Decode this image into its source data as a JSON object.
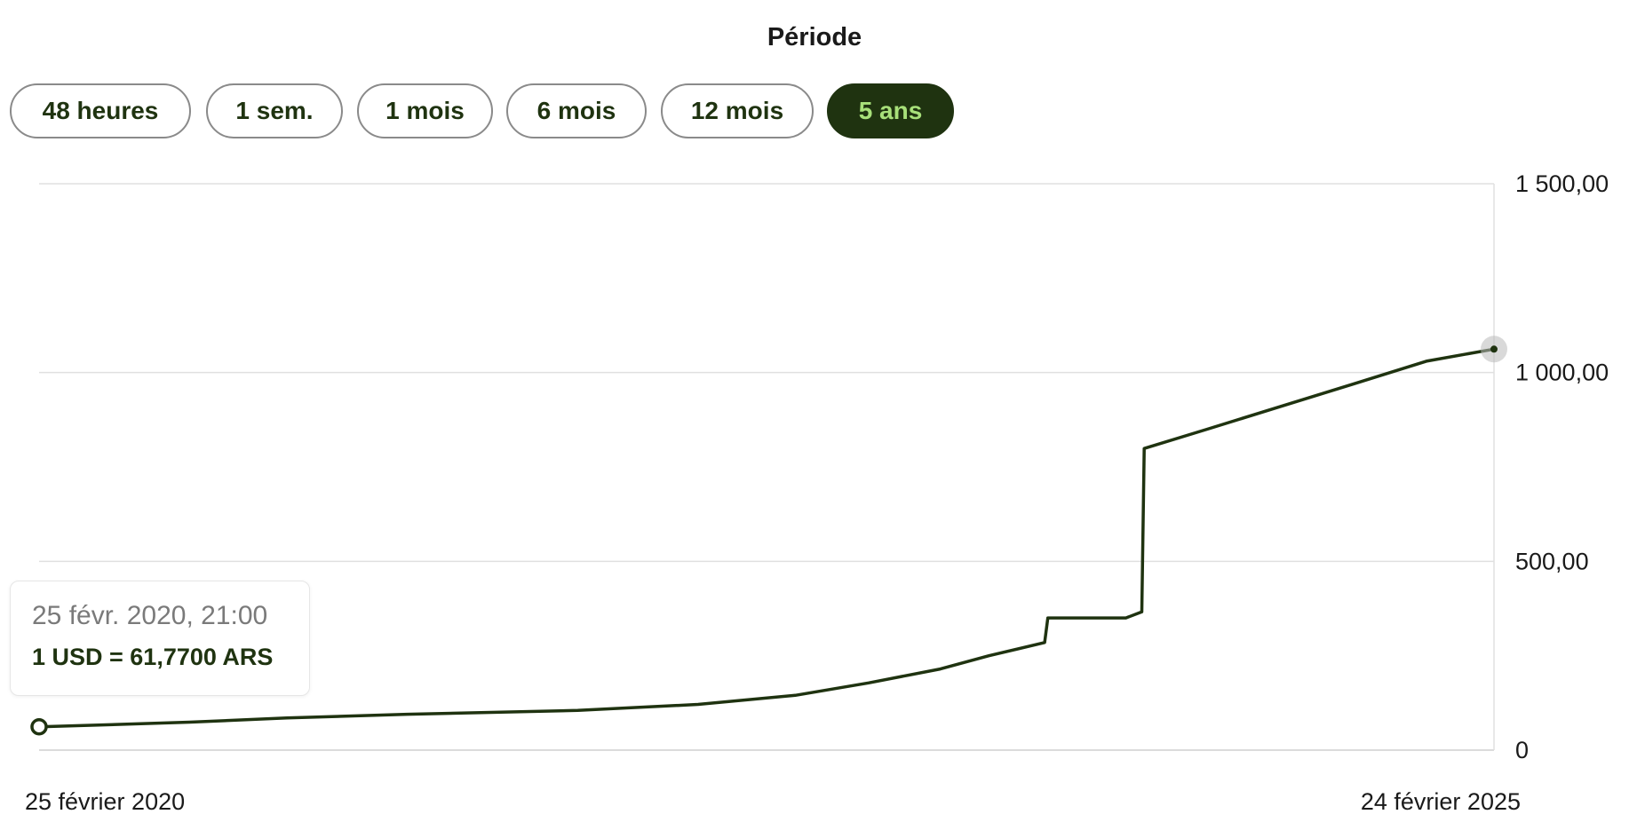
{
  "period": {
    "title": "Période",
    "tabs": [
      {
        "label": "48 heures",
        "active": false
      },
      {
        "label": "1 sem.",
        "active": false
      },
      {
        "label": "1 mois",
        "active": false
      },
      {
        "label": "6 mois",
        "active": false
      },
      {
        "label": "12 mois",
        "active": false
      },
      {
        "label": "5 ans",
        "active": true
      }
    ]
  },
  "tooltip": {
    "date": "25 févr. 2020, 21:00",
    "rate": "1 USD = 61,7700 ARS"
  },
  "colors": {
    "line": "#1f3310",
    "active_tab_bg": "#1f3310",
    "active_tab_text": "#a8e07a",
    "grid": "#e0e0e0"
  },
  "chart_data": {
    "type": "line",
    "title": "",
    "xlabel": "",
    "ylabel": "",
    "x_start_label": "25 février 2020",
    "x_end_label": "24 février 2025",
    "xlim": [
      "2020-02-25",
      "2025-02-24"
    ],
    "ylim": [
      0,
      1500
    ],
    "y_ticks": [
      0,
      500,
      1000,
      1500
    ],
    "y_tick_labels": [
      "0",
      "500,00",
      "1 000,00",
      "1 500,00"
    ],
    "grid": true,
    "y_axis_position": "right",
    "series": [
      {
        "points": [
          [
            "2020-02-25",
            61.77
          ],
          [
            "2020-06-01",
            68
          ],
          [
            "2020-09-01",
            74
          ],
          [
            "2021-01-01",
            85
          ],
          [
            "2021-06-01",
            95
          ],
          [
            "2022-01-01",
            105
          ],
          [
            "2022-06-01",
            121
          ],
          [
            "2022-10-01",
            145
          ],
          [
            "2023-01-01",
            178
          ],
          [
            "2023-04-01",
            215
          ],
          [
            "2023-06-01",
            250
          ],
          [
            "2023-08-10",
            285
          ],
          [
            "2023-08-14",
            350
          ],
          [
            "2023-11-20",
            350
          ],
          [
            "2023-12-10",
            366
          ],
          [
            "2023-12-13",
            799
          ],
          [
            "2024-03-01",
            850
          ],
          [
            "2024-06-01",
            910
          ],
          [
            "2024-09-01",
            970
          ],
          [
            "2024-12-01",
            1030
          ],
          [
            "2025-02-24",
            1062
          ]
        ]
      }
    ],
    "highlight_start": [
      "2020-02-25",
      61.77
    ],
    "highlight_end": [
      "2025-02-24",
      1062
    ]
  }
}
